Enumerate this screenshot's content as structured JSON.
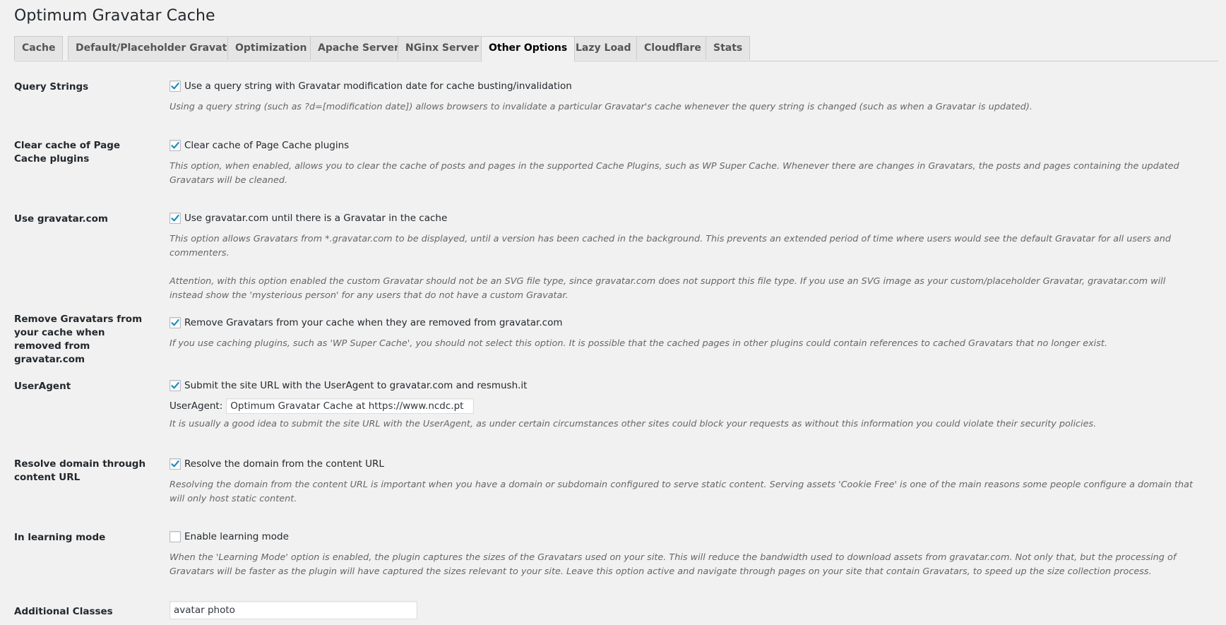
{
  "page": {
    "title": "Optimum Gravatar Cache"
  },
  "tabs": [
    {
      "label": "Cache"
    },
    {
      "label": "Default/Placeholder Gravatar"
    },
    {
      "label": "Optimization"
    },
    {
      "label": "Apache Server"
    },
    {
      "label": "NGinx Server"
    },
    {
      "label": "Other Options"
    },
    {
      "label": "Lazy Load"
    },
    {
      "label": "Cloudflare"
    },
    {
      "label": "Stats"
    }
  ],
  "active_tab": "Other Options",
  "rows": {
    "query_strings": {
      "label": "Query Strings",
      "checkbox_label": "Use a query string with Gravatar modification date for cache busting/invalidation",
      "checked": true,
      "description": "Using a query string (such as ?d=[modification date]) allows browsers to invalidate a particular Gravatar's cache whenever the query string is changed (such as when a Gravatar is updated)."
    },
    "clear_cache": {
      "label": "Clear cache of Page Cache plugins",
      "checkbox_label": "Clear cache of Page Cache plugins",
      "checked": true,
      "description": "This option, when enabled, allows you to clear the cache of posts and pages in the supported Cache Plugins, such as WP Super Cache. Whenever there are changes in Gravatars, the posts and pages containing the updated Gravatars will be cleaned."
    },
    "use_gravatar": {
      "label": "Use gravatar.com",
      "checkbox_label": "Use gravatar.com until there is a Gravatar in the cache",
      "checked": true,
      "description": "This option allows Gravatars from *.gravatar.com to be displayed, until a version has been cached in the background. This prevents an extended period of time where users would see the default Gravatar for all users and commenters.",
      "attention": "Attention, with this option enabled the custom Gravatar should not be an SVG file type, since gravatar.com does not support this file type. If you use an SVG image as your custom/placeholder Gravatar, gravatar.com will instead show the 'mysterious person' for any users that do not have a custom Gravatar."
    },
    "remove_gravatars": {
      "label": "Remove Gravatars from your cache when removed from gravatar.com",
      "checkbox_label": "Remove Gravatars from your cache when they are removed from gravatar.com",
      "checked": true,
      "description": "If you use caching plugins, such as 'WP Super Cache', you should not select this option. It is possible that the cached pages in other plugins could contain references to cached Gravatars that no longer exist."
    },
    "useragent": {
      "label": "UserAgent",
      "checkbox_label": "Submit the site URL with the UserAgent to gravatar.com and resmush.it",
      "checked": true,
      "input_label": "UserAgent:",
      "input_value": "Optimum Gravatar Cache at https://www.ncdc.pt",
      "description": "It is usually a good idea to submit the site URL with the UserAgent, as under certain circumstances other sites could block your requests as without this information you could violate their security policies."
    },
    "resolve_domain": {
      "label": "Resolve domain through content URL",
      "checkbox_label": "Resolve the domain from the content URL",
      "checked": true,
      "description": "Resolving the domain from the content URL is important when you have a domain or subdomain configured to serve static content. Serving assets 'Cookie Free' is one of the main reasons some people configure a domain that will only host static content."
    },
    "learning_mode": {
      "label": "In learning mode",
      "checkbox_label": "Enable learning mode",
      "checked": false,
      "description": "When the 'Learning Mode' option is enabled, the plugin captures the sizes of the Gravatars used on your site. This will reduce the bandwidth used to download assets from gravatar.com. Not only that, but the processing of Gravatars will be faster as the plugin will have captured the sizes relevant to your site. Leave this option active and navigate through pages on your site that contain Gravatars, to speed up the size collection process."
    },
    "additional_classes": {
      "label": "Additional Classes",
      "input_value": "avatar photo"
    }
  },
  "colors": {
    "background": "#f1f1f1",
    "checkmark": "#1e8cbe",
    "description_text": "#666666"
  }
}
